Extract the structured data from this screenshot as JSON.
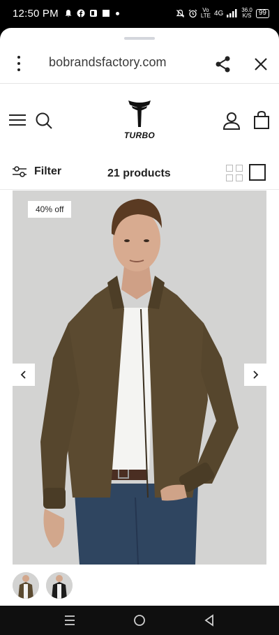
{
  "status_bar": {
    "time": "12:50 PM",
    "network_label_top": "Vo",
    "network_label_bottom": "LTE",
    "network_type": "4G",
    "speed_value": "36.0",
    "speed_unit": "K/S",
    "battery": "99"
  },
  "browser": {
    "url": "bobrandsfactory.com"
  },
  "store": {
    "logo_text": "TURBO"
  },
  "toolbar": {
    "filter_label": "Filter",
    "product_count": "21 products"
  },
  "product": {
    "discount_badge": "40% off"
  },
  "colors": {
    "jacket": "#5a4a2f",
    "accent_dark": "#222222",
    "background_image": "#d2d2d1"
  }
}
